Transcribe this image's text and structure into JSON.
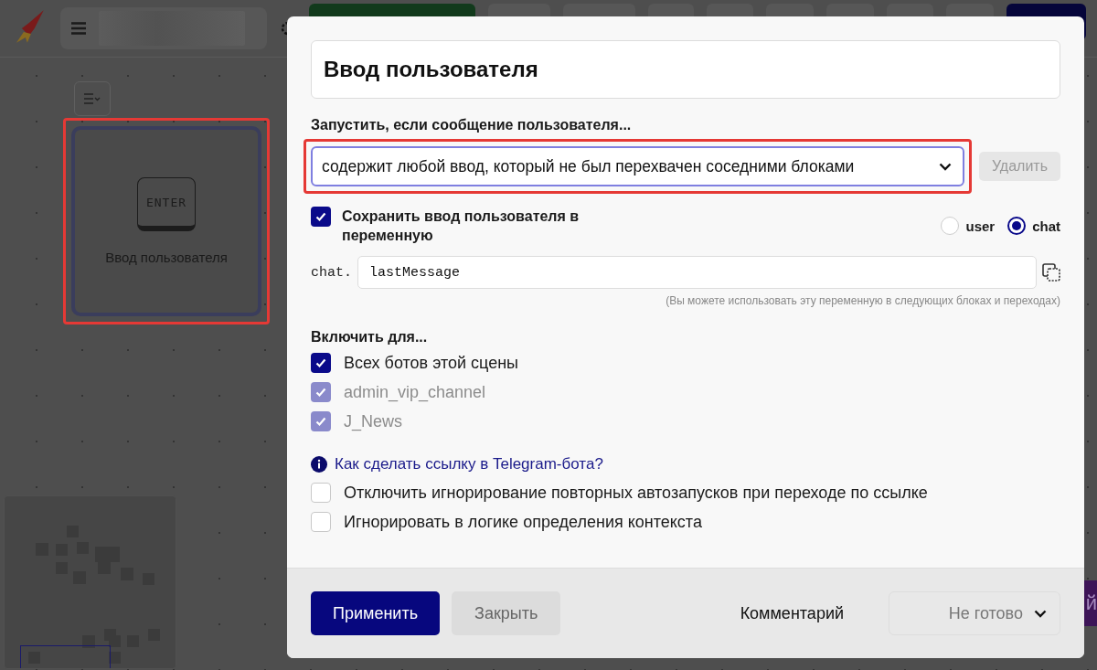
{
  "node": {
    "title": "Ввод пользователя",
    "key_label": "ENTER",
    "highlighted": true
  },
  "behind_button": {
    "label": "й"
  },
  "dialog": {
    "name_field": {
      "value": "Ввод пользователя"
    },
    "trigger": {
      "label": "Запустить, если сообщение пользователя...",
      "value": "содержит любой ввод, который не был перехвачен соседними блоками",
      "highlighted": true,
      "delete_button": {
        "label": "Удалить",
        "disabled": true
      }
    },
    "save": {
      "label": "Сохранить ввод пользователя в переменную",
      "checked": true,
      "scopes": [
        {
          "label": "user",
          "selected": false
        },
        {
          "label": "chat",
          "selected": true
        }
      ],
      "prefix": "chat.",
      "variable": "lastMessage",
      "hint": "(Вы можете использовать эту переменную в следующих блоках и переходах)"
    },
    "enable_for": {
      "label": "Включить для...",
      "items": [
        {
          "label": "Всех ботов этой сцены",
          "checked": true,
          "disabled": false
        },
        {
          "label": "admin_vip_channel",
          "checked": true,
          "disabled": true
        },
        {
          "label": "J_News",
          "checked": true,
          "disabled": true
        }
      ]
    },
    "help_link": "Как сделать ссылку в Telegram-бота?",
    "options": [
      {
        "label": "Отключить игнорирование повторных автозапусков при переходе по ссылке",
        "checked": false
      },
      {
        "label": "Игнорировать в логике определения контекста",
        "checked": false
      }
    ],
    "footer": {
      "apply": "Применить",
      "close": "Закрыть",
      "comment": "Комментарий",
      "status": "Не готово"
    }
  }
}
